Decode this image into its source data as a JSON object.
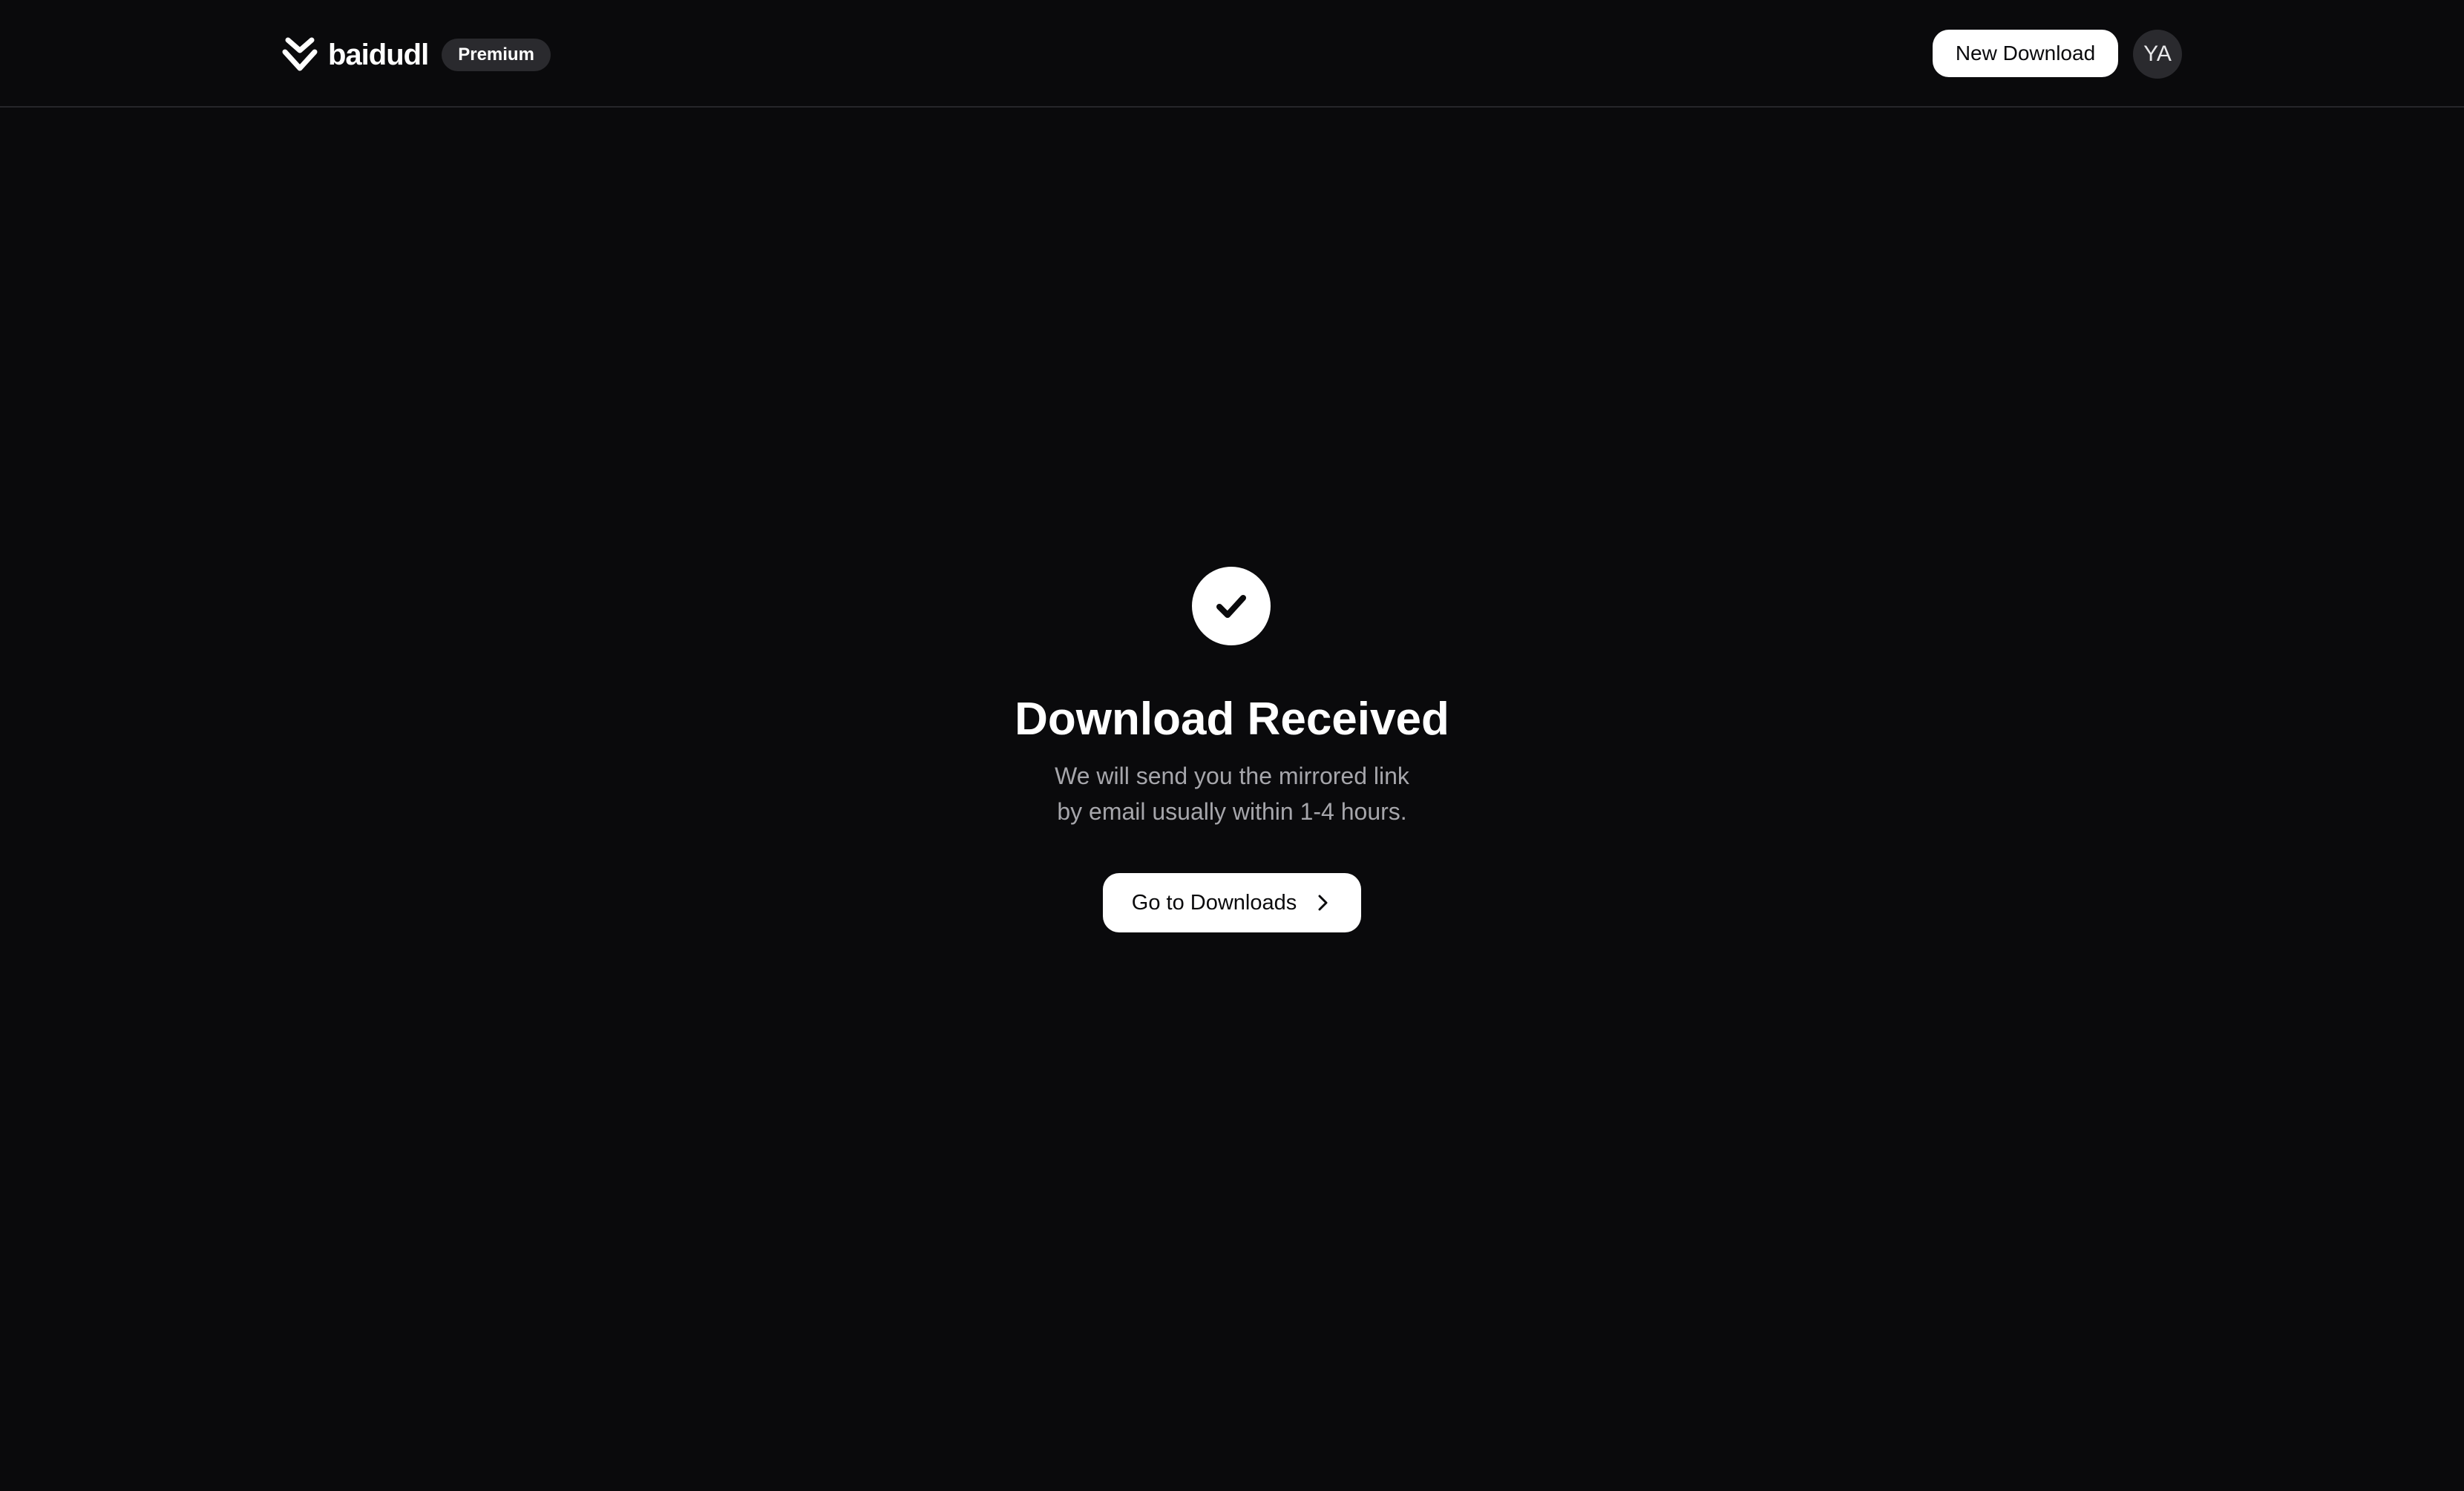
{
  "header": {
    "brand_name": "baidudl",
    "badge": "Premium",
    "new_download_label": "New Download",
    "avatar_initials": "YA",
    "logo_icon": "double-chevron-down-icon"
  },
  "main": {
    "status_icon": "check-circle-icon",
    "title": "Download Received",
    "subtitle_line1": "We will send you the mirrored link",
    "subtitle_line2": "by email usually within 1-4 hours.",
    "cta_label": "Go to Downloads",
    "cta_icon": "chevron-right-icon"
  },
  "colors": {
    "background": "#0a0a0c",
    "text_primary": "#ffffff",
    "text_muted": "#a6a6ab",
    "badge_bg": "#2a2a2e",
    "button_bg": "#ffffff"
  }
}
